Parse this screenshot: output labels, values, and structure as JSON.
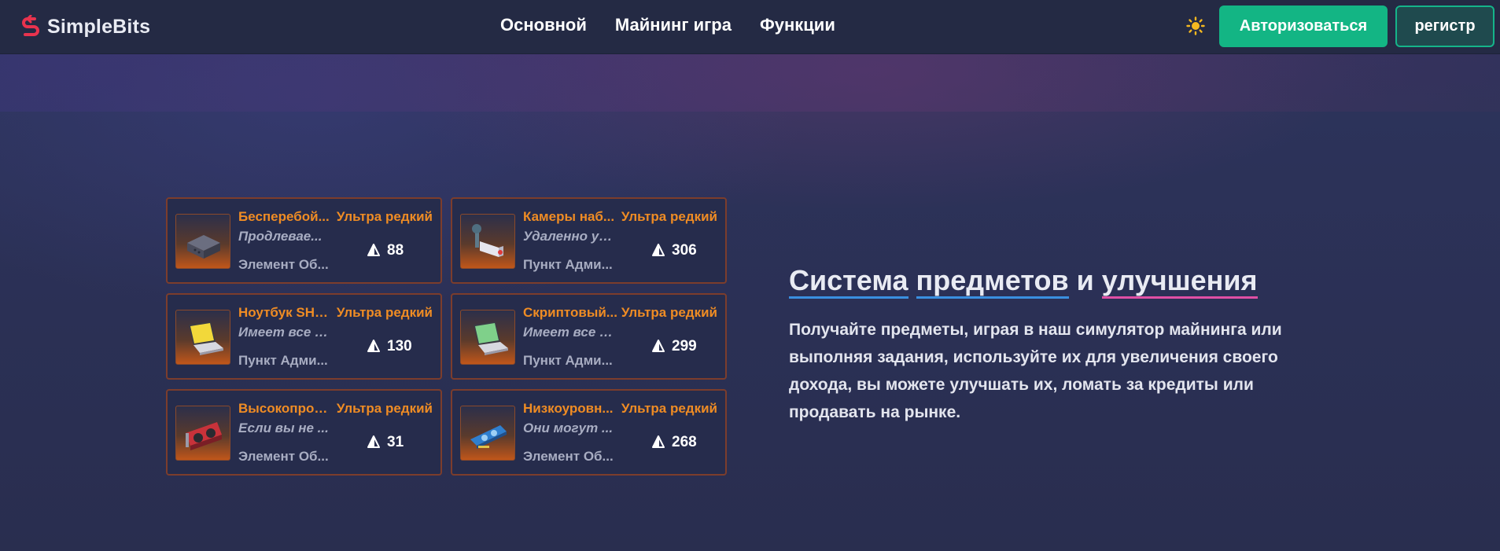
{
  "header": {
    "brand": "SimpleBits",
    "nav": [
      "Основной",
      "Майнинг игра",
      "Функции"
    ],
    "theme_icon": "sun-icon",
    "login_label": "Авторизоваться",
    "register_label": "регистр"
  },
  "colors": {
    "accent_green": "#13b584",
    "rarity_orange": "#ef8c24",
    "brand_red": "#e8334e"
  },
  "items": [
    {
      "name": "Бесперебой...",
      "rarity": "Ультра редкий",
      "desc": "Продлевае...",
      "type": "Элемент Об...",
      "price": "88",
      "icon": "ups-box-icon"
    },
    {
      "name": "Камеры наб...",
      "rarity": "Ультра редкий",
      "desc": "Удаленно уб...",
      "type": "Пункт Адми...",
      "price": "306",
      "icon": "security-camera-icon"
    },
    {
      "name": "Ноутбук SHA...",
      "rarity": "Ультра редкий",
      "desc": "Имеет все н...",
      "type": "Пункт Адми...",
      "price": "130",
      "icon": "yellow-laptop-icon"
    },
    {
      "name": "Скриптовый...",
      "rarity": "Ультра редкий",
      "desc": "Имеет все н...",
      "type": "Пункт Адми...",
      "price": "299",
      "icon": "green-laptop-icon"
    },
    {
      "name": "Высокопрои...",
      "rarity": "Ультра редкий",
      "desc": "Если вы не ...",
      "type": "Элемент Об...",
      "price": "31",
      "icon": "red-gpu-icon"
    },
    {
      "name": "Низкоуровн...",
      "rarity": "Ультра редкий",
      "desc": "Они могут ...",
      "type": "Элемент Об...",
      "price": "268",
      "icon": "blue-gpu-icon"
    }
  ],
  "section": {
    "title_part1": "Система",
    "title_part2": "предметов",
    "title_part3": "и",
    "title_part4": "улучшения",
    "description": "Получайте предметы, играя в наш симулятор майнинга или выполняя задания, используйте их для увеличения своего дохода, вы можете улучшать их, ломать за кредиты или продавать на рынке."
  }
}
